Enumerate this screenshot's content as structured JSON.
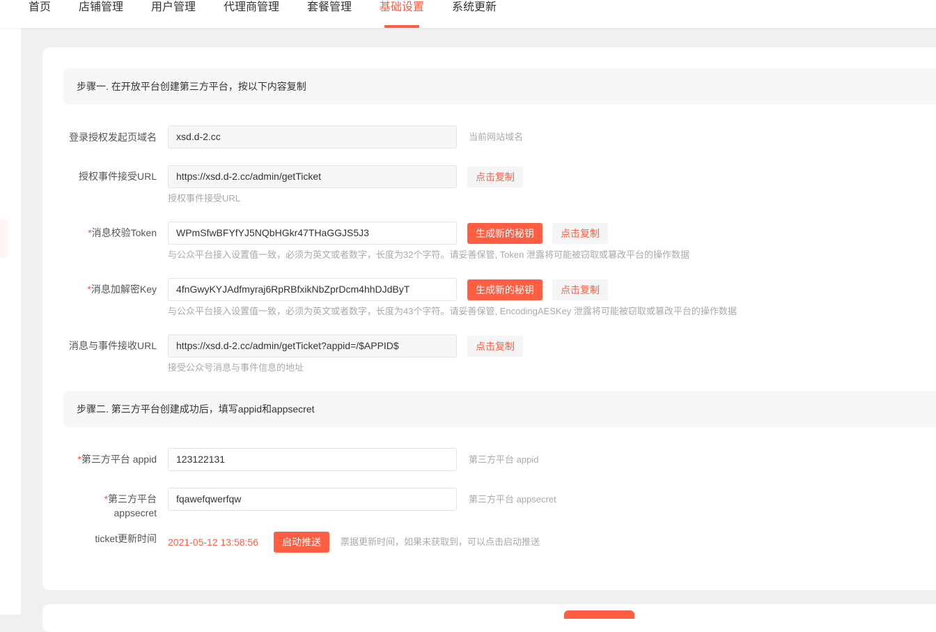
{
  "nav": {
    "items": [
      "首页",
      "店铺管理",
      "用户管理",
      "代理商管理",
      "套餐管理",
      "基础设置",
      "系统更新"
    ],
    "active_index": 5
  },
  "colors": {
    "accent": "#ff5e42",
    "required": "#ff4d4f",
    "hint": "#aaaaaa"
  },
  "step1": {
    "title": "步骤一. 在开放平台创建第三方平台，按以下内容复制"
  },
  "step2": {
    "title": "步骤二. 第三方平台创建成功后，填写appid和appsecret"
  },
  "fields": {
    "login_domain": {
      "label": "登录授权发起页域名",
      "value": "xsd.d-2.cc",
      "hint": "当前网站域名"
    },
    "auth_url": {
      "label": "授权事件接受URL",
      "value": "https://xsd.d-2.cc/admin/getTicket",
      "hint": "授权事件接受URL",
      "copy": "点击复制"
    },
    "token": {
      "required": "*",
      "label": "消息校验Token",
      "value": "WPmSfwBFYfYJ5NQbHGkr47THaGGJS5J3",
      "generate": "生成新的秘钥",
      "copy": "点击复制",
      "hint": "与公众平台接入设置值一致，必须为英文或者数字，长度为32个字符。请妥善保管, Token 泄露将可能被窃取或篡改平台的操作数据"
    },
    "aes_key": {
      "required": "*",
      "label": "消息加解密Key",
      "value": "4fnGwyKYJAdfmyraj6RpRBfxikNbZprDcm4hhDJdByT",
      "generate": "生成新的秘钥",
      "copy": "点击复制",
      "hint": "与公众平台接入设置值一致，必须为英文或者数字，长度为43个字符。请妥善保管, EncodingAESKey 泄露将可能被窃取或篡改平台的操作数据"
    },
    "msg_url": {
      "label": "消息与事件接收URL",
      "value": "https://xsd.d-2.cc/admin/getTicket?appid=/$APPID$",
      "copy": "点击复制",
      "hint": "接受公众号消息与事件信息的地址"
    },
    "appid": {
      "required": "*",
      "label": "第三方平台 appid",
      "value": "123122131",
      "hint": "第三方平台 appid"
    },
    "appsecret": {
      "required": "*",
      "label_line1": "第三方平台",
      "label_line2": "appsecret",
      "value": "fqawefqwerfqw",
      "hint": "第三方平台 appsecret"
    },
    "ticket": {
      "label": "ticket更新时间",
      "value": "2021-05-12 13:58:56",
      "button": "启动推送",
      "hint": "票据更新时间，如果未获取到，可以点击启动推送"
    }
  }
}
